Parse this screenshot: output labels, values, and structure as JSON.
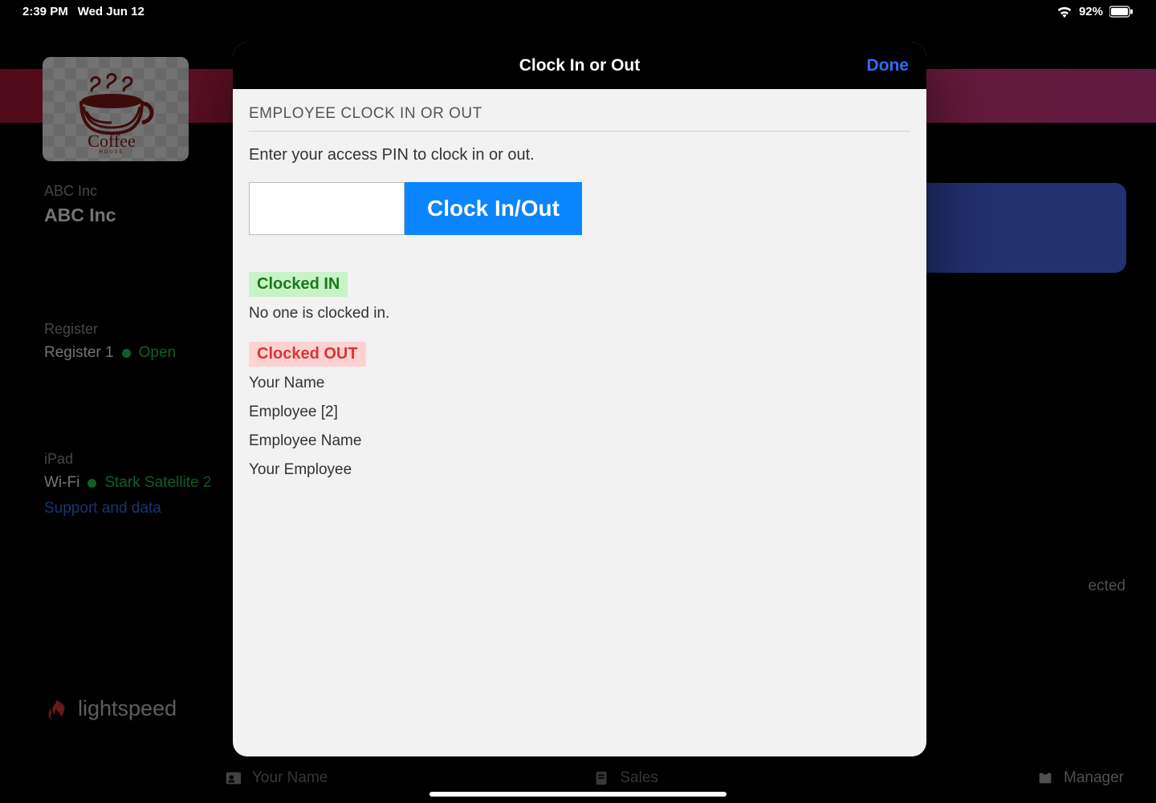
{
  "statusbar": {
    "time": "2:39 PM",
    "date": "Wed Jun 12",
    "battery_pct": "92%"
  },
  "company": {
    "subtitle": "ABC Inc",
    "title": "ABC Inc"
  },
  "register": {
    "label": "Register",
    "name": "Register 1",
    "status": "Open"
  },
  "device": {
    "label": "iPad",
    "conn_label": "Wi-Fi",
    "wifi_name": "Stark Satellite 2",
    "support_link": "Support and data"
  },
  "brand": {
    "name": "lightspeed"
  },
  "bottom": {
    "user": "Your Name",
    "mode": "Sales",
    "role": "Manager",
    "side_word": "ected"
  },
  "modal": {
    "title": "Clock In or Out",
    "done": "Done",
    "section_title": "EMPLOYEE CLOCK IN OR OUT",
    "instruction": "Enter your access PIN to clock in or out.",
    "pin_value": "",
    "clock_button": "Clock In/Out",
    "in_heading": "Clocked IN",
    "in_empty": "No one is clocked in.",
    "out_heading": "Clocked OUT",
    "out_employees": [
      "Your Name",
      "Employee [2]",
      "Employee Name",
      "Your Employee"
    ]
  }
}
